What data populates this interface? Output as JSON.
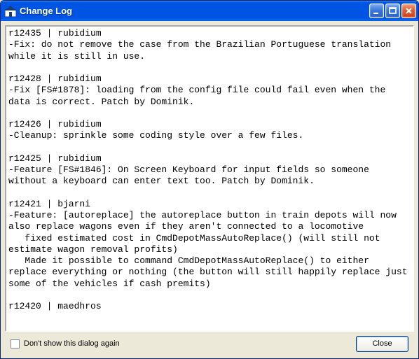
{
  "window": {
    "title": "Change Log"
  },
  "log_text": "r12435 | rubidium\n-Fix: do not remove the case from the Brazilian Portuguese translation while it is still in use.\n\nr12428 | rubidium\n-Fix [FS#1878]: loading from the config file could fail even when the data is correct. Patch by Dominik.\n\nr12426 | rubidium\n-Cleanup: sprinkle some coding style over a few files.\n\nr12425 | rubidium\n-Feature [FS#1846]: On Screen Keyboard for input fields so someone without a keyboard can enter text too. Patch by Dominik.\n\nr12421 | bjarni\n-Feature: [autoreplace] the autoreplace button in train depots will now also replace wagons even if they aren't connected to a locomotive\n   fixed estimated cost in CmdDepotMassAutoReplace() (will still not estimate wagon removal profits)\n   Made it possible to command CmdDepotMassAutoReplace() to either replace everything or nothing (the button will still happily replace just some of the vehicles if cash premits)\n\nr12420 | maedhros\n",
  "footer": {
    "dont_show_label": "Don't show this dialog again",
    "close_label": "Close"
  }
}
